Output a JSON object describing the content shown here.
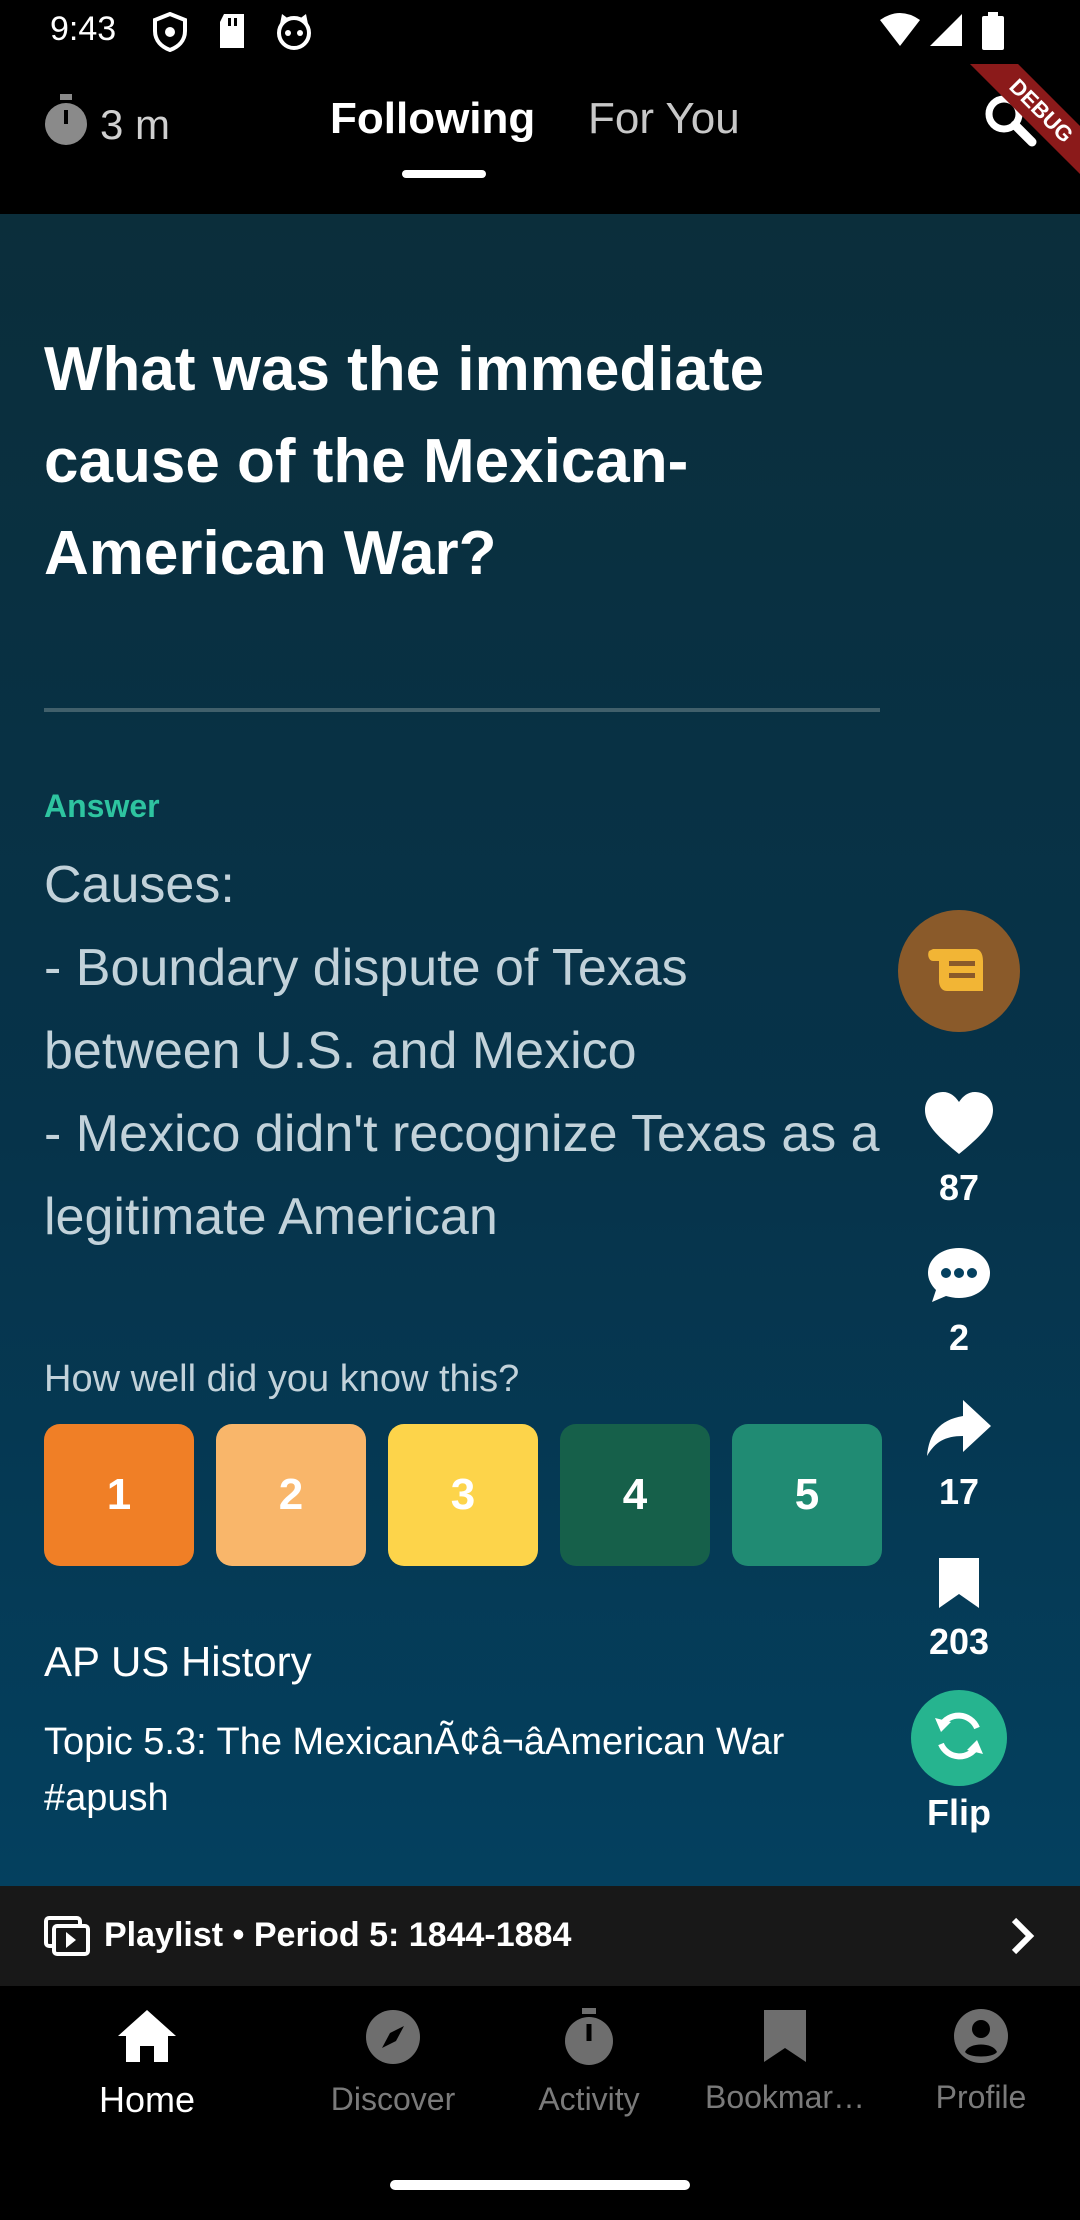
{
  "status_bar": {
    "time": "9:43",
    "icons": [
      "shield-icon",
      "sd-card-icon",
      "cat-icon",
      "wifi-icon",
      "signal-icon",
      "battery-icon"
    ]
  },
  "top_nav": {
    "timer_icon": "stopwatch-icon",
    "timer_text": "3 m",
    "tabs": [
      {
        "label": "Following",
        "active": true
      },
      {
        "label": "For You",
        "active": false
      }
    ],
    "search_icon": "search-icon",
    "debug_banner": "DEBUG"
  },
  "card": {
    "question": "What was the immediate cause of the Mexican-American War?",
    "answer_label": "Answer",
    "answer_text": "Causes:\n- Boundary dispute of Texas between U.S. and Mexico\n- Mexico didn't recognize Texas as a legitimate American",
    "rate_prompt": "How well did you know this?",
    "ratings": [
      {
        "label": "1",
        "color": "#f07f26"
      },
      {
        "label": "2",
        "color": "#f9b66a"
      },
      {
        "label": "3",
        "color": "#fdd44a"
      },
      {
        "label": "4",
        "color": "#16604a"
      },
      {
        "label": "5",
        "color": "#208b73"
      }
    ],
    "deck": "AP US History",
    "topic": "Topic 5.3: The MexicanÃ¢â¬âAmerican War #apush"
  },
  "side_actions": {
    "likes": "87",
    "comments": "2",
    "shares": "17",
    "bookmarks": "203",
    "flip_label": "Flip"
  },
  "playlist": {
    "text": "Playlist • Period 5: 1844-1884"
  },
  "bottom_nav": {
    "items": [
      {
        "label": "Home",
        "icon": "home-icon",
        "active": true
      },
      {
        "label": "Discover",
        "icon": "compass-icon",
        "active": false
      },
      {
        "label": "Activity",
        "icon": "stopwatch-icon",
        "active": false
      },
      {
        "label": "Bookmar…",
        "icon": "bookmark-icon",
        "active": false
      },
      {
        "label": "Profile",
        "icon": "profile-icon",
        "active": false
      }
    ]
  },
  "colors": {
    "accent_teal": "#2ec4a0",
    "card_bg_top": "#0b2e3b",
    "card_bg_bottom": "#04405f"
  }
}
